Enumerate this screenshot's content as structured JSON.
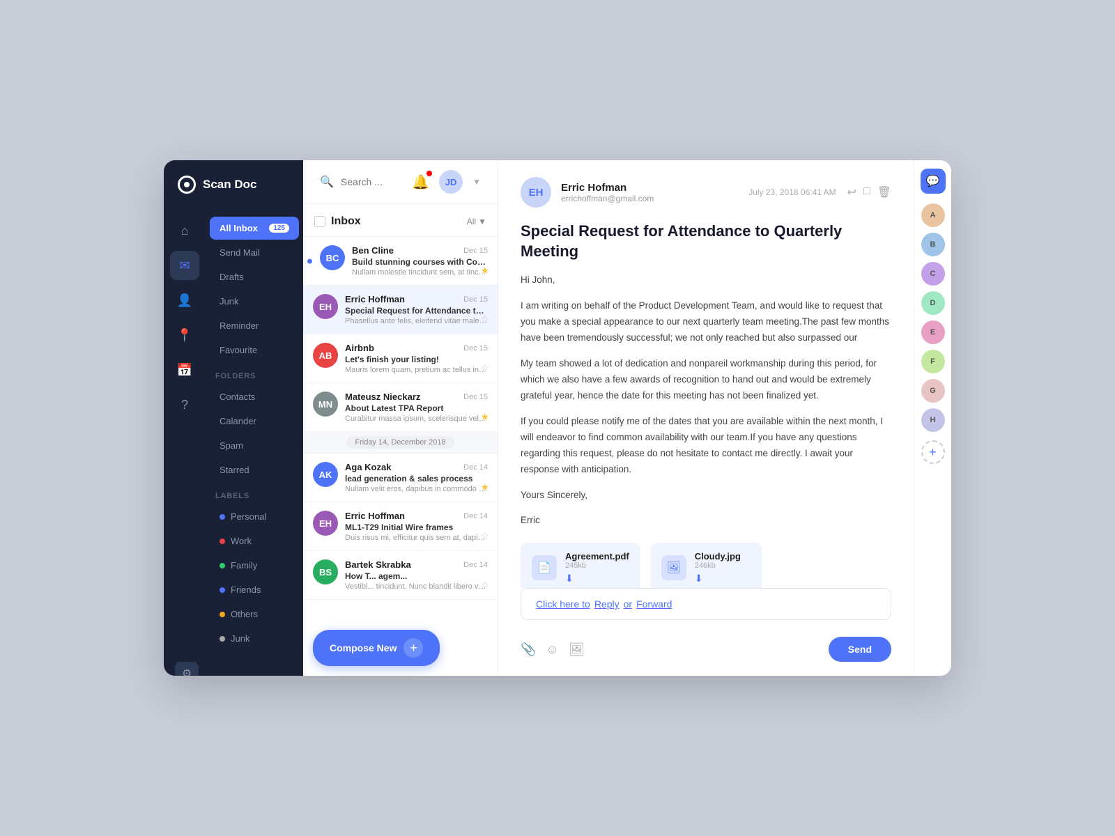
{
  "app": {
    "name": "Scan Doc"
  },
  "search": {
    "placeholder": "Search ..."
  },
  "sidebar": {
    "nav_items": [
      {
        "id": "all-inbox",
        "label": "All Inbox",
        "badge": "125",
        "active": true
      },
      {
        "id": "send-mail",
        "label": "Send Mail"
      },
      {
        "id": "drafts",
        "label": "Drafts"
      },
      {
        "id": "junk",
        "label": "Junk"
      },
      {
        "id": "reminder",
        "label": "Reminder"
      },
      {
        "id": "favourite",
        "label": "Favourite"
      }
    ],
    "folders_title": "Folders",
    "folders": [
      {
        "id": "contacts",
        "label": "Contacts"
      },
      {
        "id": "calander",
        "label": "Calander"
      },
      {
        "id": "spam",
        "label": "Spam"
      },
      {
        "id": "starred",
        "label": "Starred"
      }
    ],
    "labels_title": "Labels",
    "labels": [
      {
        "id": "personal",
        "label": "Personal",
        "color": "#4e73f8"
      },
      {
        "id": "work",
        "label": "Work",
        "color": "#e84242"
      },
      {
        "id": "family",
        "label": "Family",
        "color": "#2ecc71"
      },
      {
        "id": "friends",
        "label": "Friends",
        "color": "#4e73f8"
      },
      {
        "id": "others",
        "label": "Others",
        "color": "#f5a623"
      },
      {
        "id": "junk-label",
        "label": "Junk",
        "color": "#aaa"
      }
    ]
  },
  "inbox": {
    "title": "Inbox",
    "filter_label": "All",
    "mails": [
      {
        "id": 1,
        "sender": "Ben Cline",
        "date": "Dec 15",
        "subject": "Build stunning courses with Content...",
        "preview": "Nullam molestie tincidunt sem, at tincidunt libero vulputate id. Sed ultr...",
        "starred": true,
        "avatar_color": "#4e73f8",
        "avatar_initials": "BC"
      },
      {
        "id": 2,
        "sender": "Erric Hoffman",
        "date": "Dec 15",
        "subject": "Special Request for Attendance to Quart...",
        "preview": "Phasellus ante felis, eleifend vitae malesuada ut, tincidunt vitae nisi. Nam...",
        "starred": false,
        "avatar_color": "#9b59b6",
        "avatar_initials": "EH",
        "active": true
      },
      {
        "id": 3,
        "sender": "Airbnb",
        "date": "Dec 15",
        "subject": "Let's finish your listing!",
        "preview": "Mauris lorem quam, pretium ac tellus in, bibendum vehicula metus. Class patent...",
        "starred": false,
        "avatar_color": "#e84242",
        "avatar_initials": "AB"
      },
      {
        "id": 4,
        "sender": "Mateusz Nieckarz",
        "date": "Dec 15",
        "subject": "About Latest TPA Report",
        "preview": "Curabitur massa ipsum, scelerisque vel mattis sit amet, faucibus in urna...",
        "starred": true,
        "avatar_color": "#555",
        "avatar_initials": "MN"
      },
      {
        "id": "divider",
        "type": "divider",
        "label": "Friday 14, December 2018"
      },
      {
        "id": 5,
        "sender": "Aga Kozak",
        "date": "Dec 14",
        "subject": "lead generation & sales process",
        "preview": "Nullam velit eros, dapibus in commodo vel, fringilla quis justo. In elementu...",
        "starred": true,
        "avatar_color": "#4e73f8",
        "avatar_initials": "AK"
      },
      {
        "id": 6,
        "sender": "Erric Hoffman",
        "date": "Dec 14",
        "subject": "ML1-T29 Initial Wire frames",
        "preview": "Duis risus mi, efficitur quis sem at, dapibus mollis tortor. Ut vulputate nisi...",
        "starred": false,
        "avatar_color": "#9b59b6",
        "avatar_initials": "EH"
      },
      {
        "id": 7,
        "sender": "Bartek Skrabka",
        "date": "Dec 14",
        "subject": "How T... agem...",
        "preview": "Vestibl... tincidunt. Nunc blandit libero vel ...",
        "starred": false,
        "avatar_color": "#27ae60",
        "avatar_initials": "BS"
      }
    ]
  },
  "mail_detail": {
    "sender_name": "Erric Hofman",
    "sender_email": "errichoffman@gmail.com",
    "date": "July 23, 2018 06:41 AM",
    "subject": "Special Request for Attendance to Quarterly Meeting",
    "body_greeting": "Hi John,",
    "body_p1": "I am writing on behalf of the Product Development Team, and would like to request that you make a special appearance to our next quarterly team meeting.The past few months have been tremendously successful; we not only reached but also surpassed our",
    "body_p2": "My team showed a lot of dedication and nonpareil workmanship during this period, for which we also have a few awards of recognition to hand out and would be extremely grateful year, hence the date for this meeting has not been finalized yet.",
    "body_p3": "If you could please notify me of the dates that you are available within the next month, I will endeavor to find common availability with our team.If you have any questions regarding this request, please do not hesitate to contact me directly. I await your response with anticipation.",
    "sign_1": "Yours Sincerely,",
    "sign_2": "Erric",
    "attachments": [
      {
        "id": 1,
        "name": "Agreement.pdf",
        "size": "245kb",
        "type": "pdf"
      },
      {
        "id": 2,
        "name": "Cloudy.jpg",
        "size": "246kb",
        "type": "image"
      }
    ],
    "reply_placeholder": "Click here to Reply or Forward",
    "reply_link_1": "Reply",
    "reply_link_2": "Forward",
    "send_button": "Send"
  },
  "compose": {
    "label": "Compose New"
  },
  "right_avatars": [
    {
      "id": 1,
      "initials": "A",
      "color": "#e8c4a0"
    },
    {
      "id": 2,
      "initials": "B",
      "color": "#a0c4e8"
    },
    {
      "id": 3,
      "initials": "C",
      "color": "#c4a0e8"
    },
    {
      "id": 4,
      "initials": "D",
      "color": "#a0e8c4"
    },
    {
      "id": 5,
      "initials": "E",
      "color": "#e8a0c4"
    },
    {
      "id": 6,
      "initials": "F",
      "color": "#c4e8a0"
    },
    {
      "id": 7,
      "initials": "G",
      "color": "#e8c4c4"
    },
    {
      "id": 8,
      "initials": "H",
      "color": "#c4c4e8"
    }
  ]
}
